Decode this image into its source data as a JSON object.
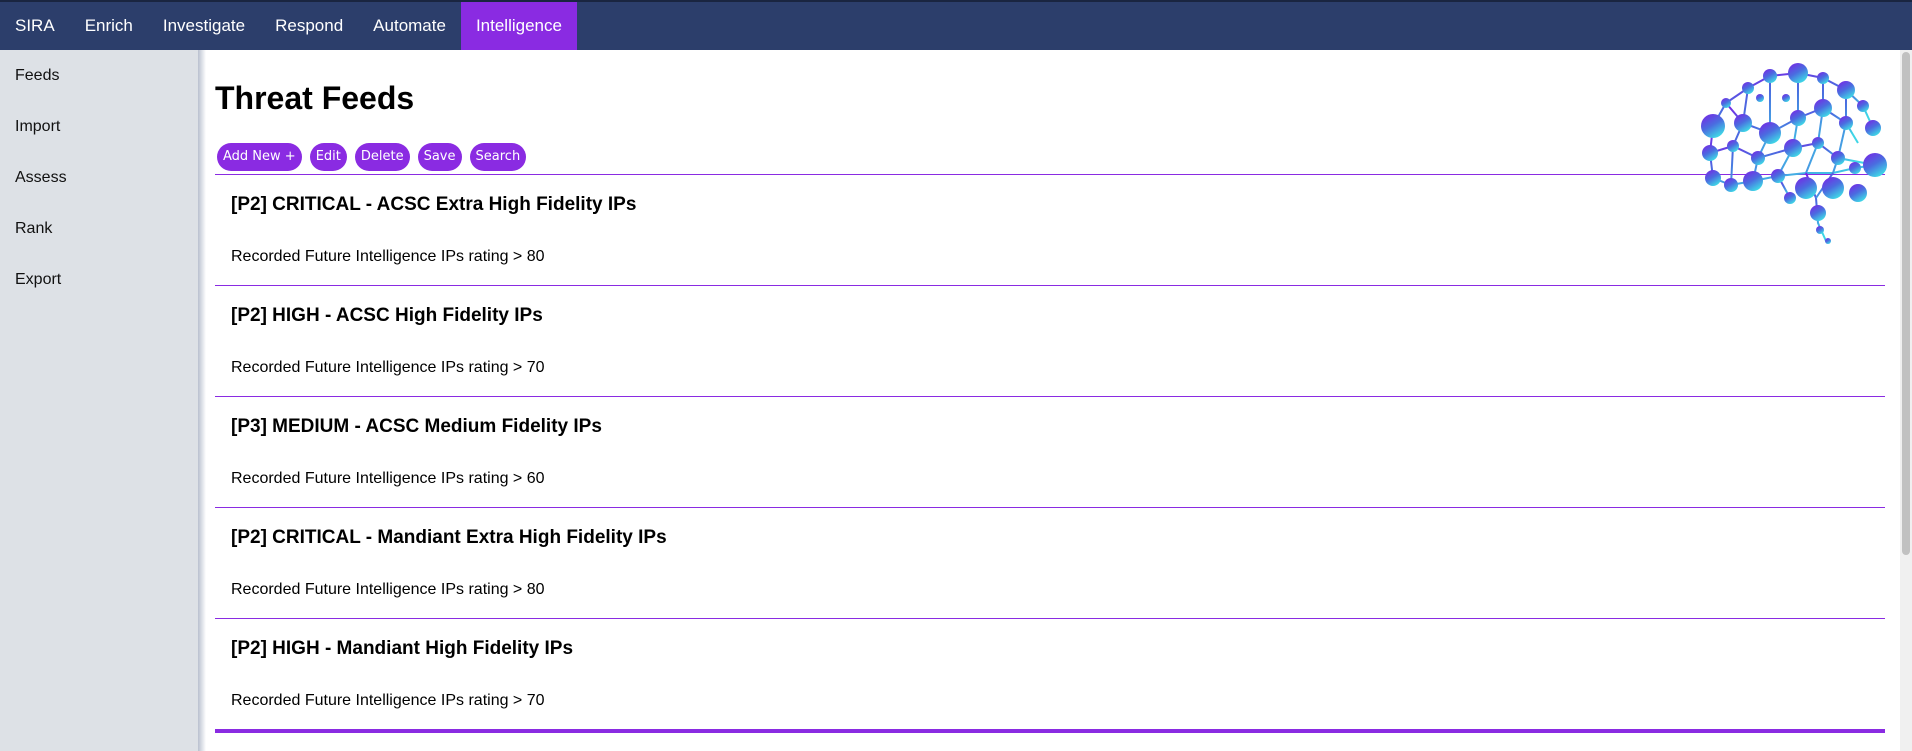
{
  "topnav": {
    "items": [
      {
        "label": "SIRA",
        "active": false
      },
      {
        "label": "Enrich",
        "active": false
      },
      {
        "label": "Investigate",
        "active": false
      },
      {
        "label": "Respond",
        "active": false
      },
      {
        "label": "Automate",
        "active": false
      },
      {
        "label": "Intelligence",
        "active": true
      }
    ]
  },
  "sidebar": {
    "items": [
      {
        "label": "Feeds"
      },
      {
        "label": "Import"
      },
      {
        "label": "Assess"
      },
      {
        "label": "Rank"
      },
      {
        "label": "Export"
      }
    ]
  },
  "main": {
    "title": "Threat Feeds",
    "toolbar": {
      "add_label": "Add New +",
      "edit_label": "Edit",
      "delete_label": "Delete",
      "save_label": "Save",
      "search_label": "Search"
    },
    "feeds": [
      {
        "title": "[P2] CRITICAL - ACSC Extra High Fidelity IPs",
        "description": "Recorded Future Intelligence IPs rating > 80"
      },
      {
        "title": "[P2] HIGH - ACSC High Fidelity IPs",
        "description": "Recorded Future Intelligence IPs rating > 70"
      },
      {
        "title": "[P3] MEDIUM - ACSC Medium Fidelity IPs",
        "description": "Recorded Future Intelligence IPs rating > 60"
      },
      {
        "title": "[P2] CRITICAL - Mandiant Extra High Fidelity IPs",
        "description": "Recorded Future Intelligence IPs rating > 80"
      },
      {
        "title": "[P2] HIGH - Mandiant High Fidelity IPs",
        "description": "Recorded Future Intelligence IPs rating > 70"
      }
    ]
  },
  "colors": {
    "nav_bg": "#2c3e6b",
    "accent": "#8a2be2",
    "sidebar_bg": "#dde1e6"
  },
  "logo": {
    "icon": "brain-network-icon"
  }
}
